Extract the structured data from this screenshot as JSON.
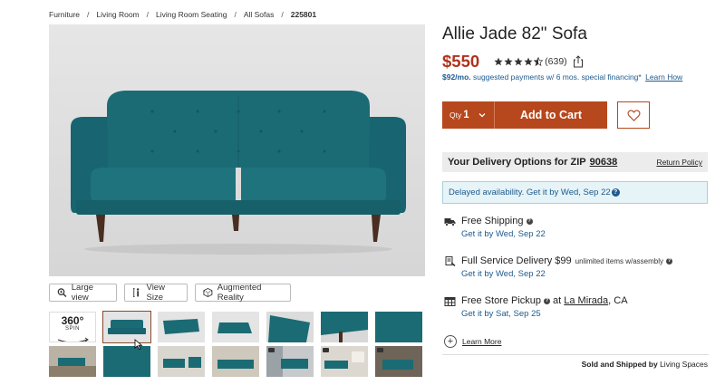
{
  "breadcrumb": {
    "items": [
      "Furniture",
      "Living Room",
      "Living Room Seating",
      "All Sofas"
    ],
    "current": "225801",
    "separator": "/"
  },
  "gallery": {
    "buttons": {
      "large_view": "Large view",
      "view_size": "View Size",
      "augmented_reality": "Augmented Reality"
    },
    "spin": {
      "number": "360°",
      "label": "SPIN"
    },
    "sofa_color": "#1b6b74"
  },
  "product": {
    "title": "Allie Jade 82\" Sofa",
    "price": "$550",
    "rating": 4.5,
    "review_count": "(639)",
    "financing_amount": "$92/mo.",
    "financing_text": "suggested payments w/ 6 mos. special financing*",
    "financing_link": "Learn How"
  },
  "cart": {
    "qty_label": "Qty",
    "qty_value": "1",
    "add_to_cart": "Add to Cart",
    "accent_color": "#b7471c"
  },
  "delivery": {
    "heading": "Your Delivery Options for ZIP",
    "zip": "90638",
    "return_policy": "Return Policy",
    "notice": "Delayed availability. Get it by Wed, Sep 22",
    "options": [
      {
        "title": "Free Shipping",
        "note": "",
        "date": "Get it by Wed, Sep 22"
      },
      {
        "title": "Full Service Delivery $99",
        "note": "unlimited items w/assembly",
        "date": "Get it by Wed, Sep 22"
      },
      {
        "title": "Free Store Pickup",
        "at": "at",
        "location": "La Mirada",
        "region": ", CA",
        "date": "Get it by Sat, Sep 25"
      }
    ],
    "learn_more": "Learn More",
    "sold_by_label": "Sold and Shipped by",
    "sold_by_value": "Living Spaces"
  }
}
